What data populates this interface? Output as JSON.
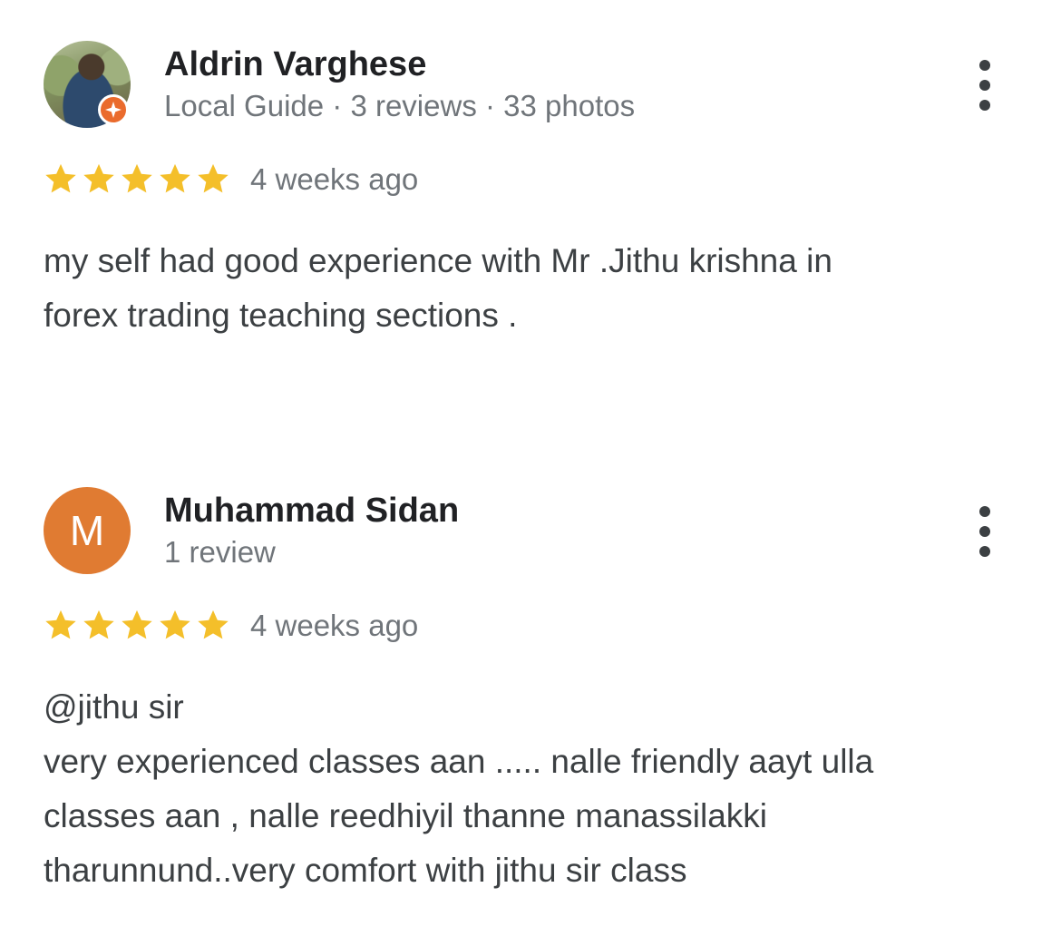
{
  "reviews": [
    {
      "name": "Aldrin Varghese",
      "meta": "Local Guide · 3 reviews · 33 photos",
      "local_guide": true,
      "rating": 5,
      "max_rating": 5,
      "time": "4 weeks ago",
      "text_lines": [
        "my self had good experience with Mr .Jithu krishna in",
        "forex trading teaching sections ."
      ]
    },
    {
      "name": "Muhammad Sidan",
      "meta": "1 review",
      "avatar_letter": "M",
      "avatar_color": "#e07b32",
      "rating": 5,
      "max_rating": 5,
      "time": "4 weeks ago",
      "text_lines": [
        "@jithu sir",
        "very experienced classes aan ..... nalle friendly aayt ulla",
        "classes aan , nalle reedhiyil thanne manassilakki",
        "tharunnund..very comfort with jithu sir class"
      ]
    }
  ],
  "colors": {
    "star": "#f4bf2a",
    "local_guide_badge": "#ea6b2d"
  },
  "icons": {
    "more_menu": "more-vertical-icon",
    "star": "star-icon",
    "local_guide": "local-guide-badge-icon"
  }
}
